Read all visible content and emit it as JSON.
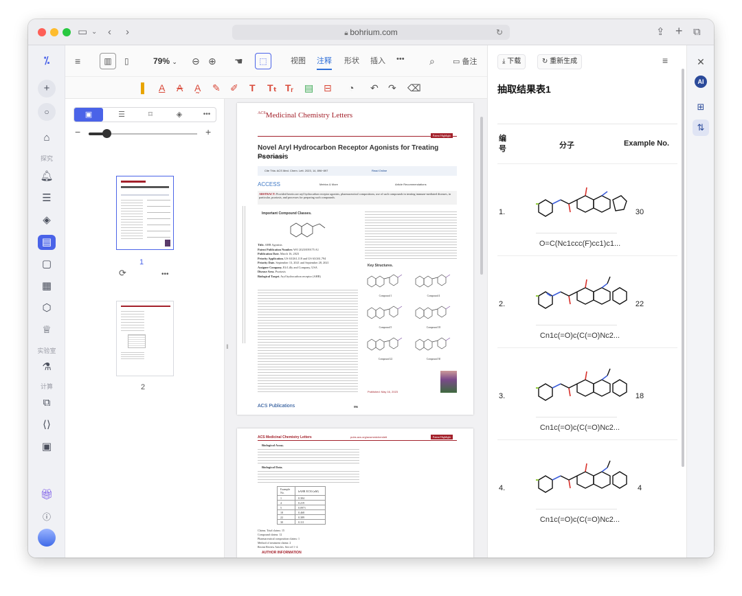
{
  "browser": {
    "url": "bohrium.com"
  },
  "nav": {
    "section_explore": "探究",
    "section_lab": "实验室",
    "section_compute": "计算"
  },
  "toolbar": {
    "zoom": "79%",
    "tabs": [
      "视图",
      "注释",
      "形状",
      "插入"
    ],
    "active_tab": "注释",
    "more": "•••",
    "note_label": "备注"
  },
  "thumbs": {
    "page1": "1",
    "page2": "2",
    "more": "•••"
  },
  "page1": {
    "journal_prefix": "ACS",
    "journal_name": "Medicinal Chemistry Letters",
    "tag": "Patent Highlight",
    "title": "Novel Aryl Hydrocarbon Receptor Agonists for Treating Psoriasis",
    "author": "Ram W. Sabnis*",
    "cite": "Cite This: ACS Med. Chem. Lett. 2023, 14, 896−897",
    "read_online": "Read Online",
    "access": "ACCESS",
    "metrics": "Metrics & More",
    "recs": "Article Recommendations",
    "abstract_label": "ABSTRACT:",
    "abstract": "Provided herein are aryl hydrocarbon receptor agonists, pharmaceutical compositions, use of such compounds in treating immune-mediated diseases, in particular, psoriasis, and processes for preparing such compounds.",
    "imp_heading": "Important Compound Classes.",
    "key_structures": "Key Structures.",
    "compounds": [
      "Compound 1",
      "Compound 4",
      "Compound 5",
      "Compound 18",
      "Compound 22",
      "Compound 30"
    ],
    "fields": [
      {
        "k": "Title.",
        "v": "AHR Agonists"
      },
      {
        "k": "Patent Publication Number.",
        "v": "WO 2023/039175 A1"
      },
      {
        "k": "Publication Date.",
        "v": "March 16, 2023"
      },
      {
        "k": "Priority Application.",
        "v": "US 63/261,118 and US 63/261,794"
      },
      {
        "k": "Priority Date.",
        "v": "September 13, 2021 and September 28, 2021"
      },
      {
        "k": "Assignee Company.",
        "v": "Eli Lilly and Company, USA"
      },
      {
        "k": "Disease Area.",
        "v": "Psoriasis"
      },
      {
        "k": "Biological Target.",
        "v": "Aryl hydrocarbon receptor (AHR)"
      }
    ],
    "published": "Published: May 16, 2023",
    "publisher": "ACS Publications",
    "page_no": "896"
  },
  "page2": {
    "journal": "ACS Medicinal Chemistry Letters",
    "url": "pubs.acs.org/acsmedchemlett",
    "tag": "Patent Highlight",
    "assay_label": "Biological Assay.",
    "data_label": "Biological Data.",
    "table_headers": [
      "Example No.",
      "hAHR EC50 (nM)"
    ],
    "table_rows": [
      [
        "1",
        "0.304"
      ],
      [
        "4",
        "0.219"
      ],
      [
        "5",
        "0.0971"
      ],
      [
        "18",
        "0.468"
      ],
      [
        "22",
        "0.389"
      ],
      [
        "30",
        "0.111"
      ]
    ],
    "claims": "Claims. Total claims: 15",
    "claims2": "Compound claims: 12",
    "claims3": "Pharmaceutical composition claims: 1",
    "claims4": "Method of treatment claims: 2",
    "review": "Recent Review Articles. See ref 1−4.",
    "author_info": "AUTHOR INFORMATION"
  },
  "panel": {
    "download": "下载",
    "regenerate": "重新生成",
    "title": "抽取结果表1",
    "col_no": "编号",
    "col_mol": "分子",
    "col_ex": "Example No.",
    "rows": [
      {
        "no": "1.",
        "smiles": "O=C(Nc1ccc(F)cc1)c1...",
        "ex": "30"
      },
      {
        "no": "2.",
        "smiles": "Cn1c(=O)c(C(=O)Nc2...",
        "ex": "22"
      },
      {
        "no": "3.",
        "smiles": "Cn1c(=O)c(C(=O)Nc2...",
        "ex": "18"
      },
      {
        "no": "4.",
        "smiles": "Cn1c(=O)c(C(=O)Nc2...",
        "ex": "4"
      }
    ]
  },
  "colors": {
    "accent": "#3b5bdb",
    "journal_red": "#a3202a",
    "tab_active": "#2f6fd8"
  }
}
